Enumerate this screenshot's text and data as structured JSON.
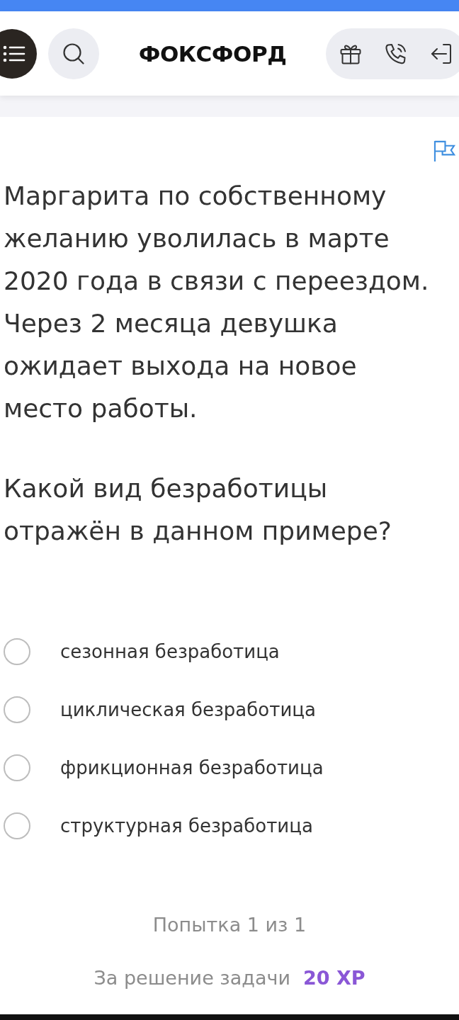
{
  "header": {
    "logo": "ФОКСФОРД"
  },
  "task": {
    "question": "Маргарита по собственному желанию уволилась в марте 2020 года в связи с переездом. Через 2 месяца девушка ожидает выхода на новое место работы.",
    "prompt": "Какой вид безработицы отражён в данном примере?"
  },
  "options": [
    {
      "label": "сезонная безработица",
      "selected": false
    },
    {
      "label": "циклическая безработица",
      "selected": false
    },
    {
      "label": "фрикционная безработица",
      "selected": false
    },
    {
      "label": "структурная безработица",
      "selected": false
    }
  ],
  "attempt": "Попытка 1 из 1",
  "reward": {
    "label": "За решение задачи",
    "value": "20 XP"
  }
}
